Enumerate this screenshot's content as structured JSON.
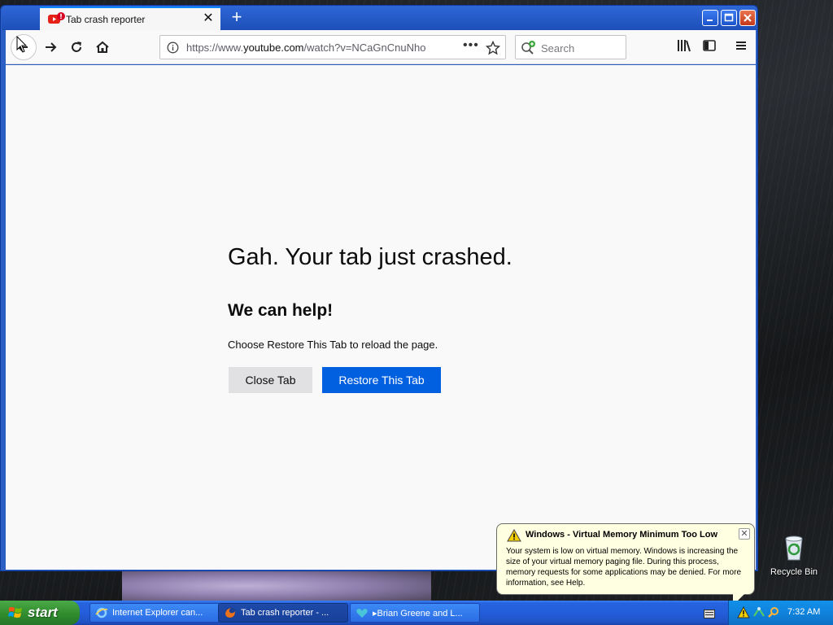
{
  "browser": {
    "tab": {
      "title": "Tab crash reporter"
    },
    "url": {
      "prefix": "https://www.",
      "domain": "youtube.com",
      "path": "/watch?v=NCaGnCnuNho"
    },
    "search": {
      "placeholder": "Search"
    }
  },
  "crash": {
    "title": "Gah. Your tab just crashed.",
    "subtitle": "We can help!",
    "description": "Choose Restore This Tab to reload the page.",
    "close_label": "Close Tab",
    "restore_label": "Restore This Tab"
  },
  "desktop": {
    "recycle_bin_label": "Recycle Bin"
  },
  "balloon": {
    "title": "Windows - Virtual Memory Minimum Too Low",
    "body": "Your system is low on virtual memory. Windows is increasing the size of your virtual memory paging file. During this process, memory requests for some applications may be denied. For more information, see Help."
  },
  "taskbar": {
    "start_label": "start",
    "tasks": [
      {
        "label": "Internet Explorer can...",
        "icon": "ie-icon"
      },
      {
        "label": "Tab crash reporter - ...",
        "icon": "firefox-icon",
        "active": true
      },
      {
        "label": "▸Brian Greene and L...",
        "icon": "media-icon"
      }
    ],
    "clock": "7:32 AM"
  },
  "colors": {
    "accent_blue": "#0060df",
    "xp_taskbar": "#245edb",
    "xp_start_green": "#3a9a37",
    "balloon_bg": "#ffffe1"
  }
}
